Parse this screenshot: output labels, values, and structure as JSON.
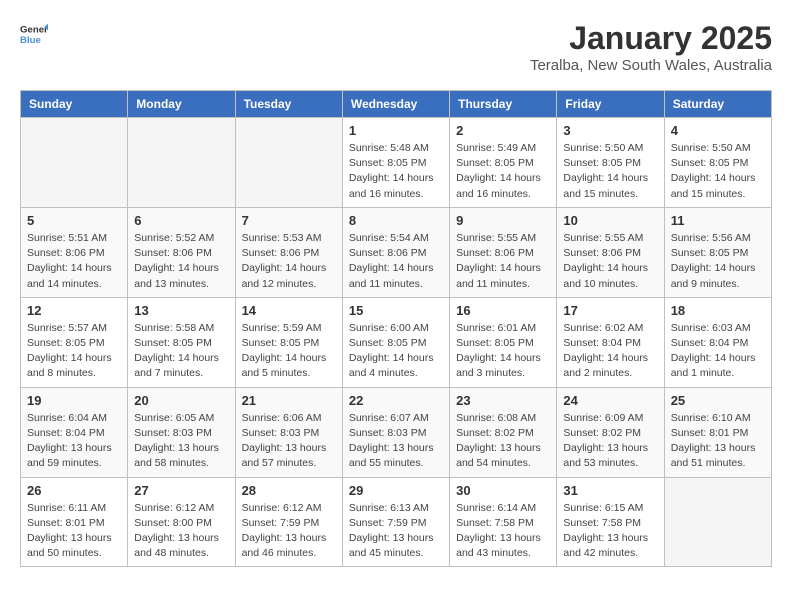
{
  "header": {
    "logo_line1": "General",
    "logo_line2": "Blue",
    "month": "January 2025",
    "location": "Teralba, New South Wales, Australia"
  },
  "weekdays": [
    "Sunday",
    "Monday",
    "Tuesday",
    "Wednesday",
    "Thursday",
    "Friday",
    "Saturday"
  ],
  "weeks": [
    [
      {
        "day": "",
        "info": ""
      },
      {
        "day": "",
        "info": ""
      },
      {
        "day": "",
        "info": ""
      },
      {
        "day": "1",
        "info": "Sunrise: 5:48 AM\nSunset: 8:05 PM\nDaylight: 14 hours\nand 16 minutes."
      },
      {
        "day": "2",
        "info": "Sunrise: 5:49 AM\nSunset: 8:05 PM\nDaylight: 14 hours\nand 16 minutes."
      },
      {
        "day": "3",
        "info": "Sunrise: 5:50 AM\nSunset: 8:05 PM\nDaylight: 14 hours\nand 15 minutes."
      },
      {
        "day": "4",
        "info": "Sunrise: 5:50 AM\nSunset: 8:05 PM\nDaylight: 14 hours\nand 15 minutes."
      }
    ],
    [
      {
        "day": "5",
        "info": "Sunrise: 5:51 AM\nSunset: 8:06 PM\nDaylight: 14 hours\nand 14 minutes."
      },
      {
        "day": "6",
        "info": "Sunrise: 5:52 AM\nSunset: 8:06 PM\nDaylight: 14 hours\nand 13 minutes."
      },
      {
        "day": "7",
        "info": "Sunrise: 5:53 AM\nSunset: 8:06 PM\nDaylight: 14 hours\nand 12 minutes."
      },
      {
        "day": "8",
        "info": "Sunrise: 5:54 AM\nSunset: 8:06 PM\nDaylight: 14 hours\nand 11 minutes."
      },
      {
        "day": "9",
        "info": "Sunrise: 5:55 AM\nSunset: 8:06 PM\nDaylight: 14 hours\nand 11 minutes."
      },
      {
        "day": "10",
        "info": "Sunrise: 5:55 AM\nSunset: 8:06 PM\nDaylight: 14 hours\nand 10 minutes."
      },
      {
        "day": "11",
        "info": "Sunrise: 5:56 AM\nSunset: 8:05 PM\nDaylight: 14 hours\nand 9 minutes."
      }
    ],
    [
      {
        "day": "12",
        "info": "Sunrise: 5:57 AM\nSunset: 8:05 PM\nDaylight: 14 hours\nand 8 minutes."
      },
      {
        "day": "13",
        "info": "Sunrise: 5:58 AM\nSunset: 8:05 PM\nDaylight: 14 hours\nand 7 minutes."
      },
      {
        "day": "14",
        "info": "Sunrise: 5:59 AM\nSunset: 8:05 PM\nDaylight: 14 hours\nand 5 minutes."
      },
      {
        "day": "15",
        "info": "Sunrise: 6:00 AM\nSunset: 8:05 PM\nDaylight: 14 hours\nand 4 minutes."
      },
      {
        "day": "16",
        "info": "Sunrise: 6:01 AM\nSunset: 8:05 PM\nDaylight: 14 hours\nand 3 minutes."
      },
      {
        "day": "17",
        "info": "Sunrise: 6:02 AM\nSunset: 8:04 PM\nDaylight: 14 hours\nand 2 minutes."
      },
      {
        "day": "18",
        "info": "Sunrise: 6:03 AM\nSunset: 8:04 PM\nDaylight: 14 hours\nand 1 minute."
      }
    ],
    [
      {
        "day": "19",
        "info": "Sunrise: 6:04 AM\nSunset: 8:04 PM\nDaylight: 13 hours\nand 59 minutes."
      },
      {
        "day": "20",
        "info": "Sunrise: 6:05 AM\nSunset: 8:03 PM\nDaylight: 13 hours\nand 58 minutes."
      },
      {
        "day": "21",
        "info": "Sunrise: 6:06 AM\nSunset: 8:03 PM\nDaylight: 13 hours\nand 57 minutes."
      },
      {
        "day": "22",
        "info": "Sunrise: 6:07 AM\nSunset: 8:03 PM\nDaylight: 13 hours\nand 55 minutes."
      },
      {
        "day": "23",
        "info": "Sunrise: 6:08 AM\nSunset: 8:02 PM\nDaylight: 13 hours\nand 54 minutes."
      },
      {
        "day": "24",
        "info": "Sunrise: 6:09 AM\nSunset: 8:02 PM\nDaylight: 13 hours\nand 53 minutes."
      },
      {
        "day": "25",
        "info": "Sunrise: 6:10 AM\nSunset: 8:01 PM\nDaylight: 13 hours\nand 51 minutes."
      }
    ],
    [
      {
        "day": "26",
        "info": "Sunrise: 6:11 AM\nSunset: 8:01 PM\nDaylight: 13 hours\nand 50 minutes."
      },
      {
        "day": "27",
        "info": "Sunrise: 6:12 AM\nSunset: 8:00 PM\nDaylight: 13 hours\nand 48 minutes."
      },
      {
        "day": "28",
        "info": "Sunrise: 6:12 AM\nSunset: 7:59 PM\nDaylight: 13 hours\nand 46 minutes."
      },
      {
        "day": "29",
        "info": "Sunrise: 6:13 AM\nSunset: 7:59 PM\nDaylight: 13 hours\nand 45 minutes."
      },
      {
        "day": "30",
        "info": "Sunrise: 6:14 AM\nSunset: 7:58 PM\nDaylight: 13 hours\nand 43 minutes."
      },
      {
        "day": "31",
        "info": "Sunrise: 6:15 AM\nSunset: 7:58 PM\nDaylight: 13 hours\nand 42 minutes."
      },
      {
        "day": "",
        "info": ""
      }
    ]
  ]
}
